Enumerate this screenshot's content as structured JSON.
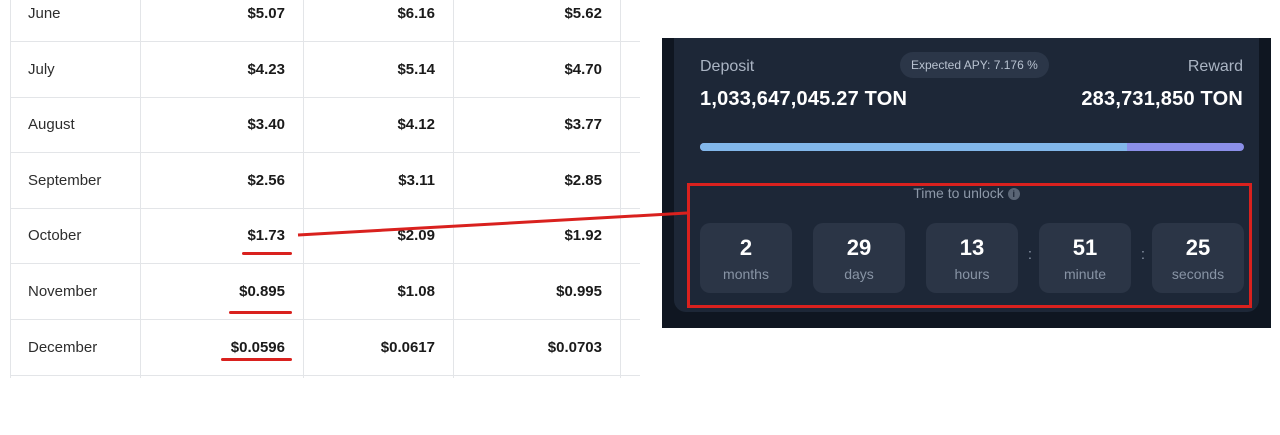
{
  "table": {
    "rows": [
      {
        "month": "June",
        "v1": "$5.07",
        "v2": "$6.16",
        "v3": "$5.62"
      },
      {
        "month": "July",
        "v1": "$4.23",
        "v2": "$5.14",
        "v3": "$4.70"
      },
      {
        "month": "August",
        "v1": "$3.40",
        "v2": "$4.12",
        "v3": "$3.77"
      },
      {
        "month": "September",
        "v1": "$2.56",
        "v2": "$3.11",
        "v3": "$2.85"
      },
      {
        "month": "October",
        "v1": "$1.73",
        "v2": "$2.09",
        "v3": "$1.92"
      },
      {
        "month": "November",
        "v1": "$0.895",
        "v2": "$1.08",
        "v3": "$0.995"
      },
      {
        "month": "December",
        "v1": "$0.0596",
        "v2": "$0.0617",
        "v3": "$0.0703"
      }
    ]
  },
  "staking": {
    "deposit_label": "Deposit",
    "deposit_value": "1,033,647,045.27 TON",
    "apy_badge": "Expected APY: 7.176 %",
    "reward_label": "Reward",
    "reward_value": "283,731,850 TON",
    "progress_fraction": 0.785,
    "unlock_title": "Time to unlock",
    "info_icon": "i",
    "countdown": [
      {
        "value": "2",
        "unit": "months"
      },
      {
        "value": "29",
        "unit": "days"
      },
      {
        "value": "13",
        "unit": "hours"
      },
      {
        "value": "51",
        "unit": "minute"
      },
      {
        "value": "25",
        "unit": "seconds"
      }
    ],
    "separator": ":"
  },
  "colors": {
    "annotation_red": "#d9211e",
    "card_bg": "#1d2737",
    "progress_blue": "#82b7ea",
    "progress_purple": "#8b8fe8"
  },
  "icons": [
    "info-icon"
  ]
}
